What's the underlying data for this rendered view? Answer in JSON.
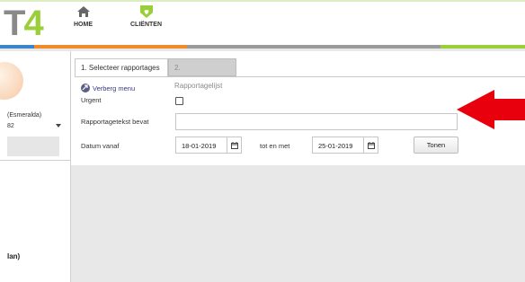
{
  "header": {
    "logo_text_a": "T",
    "logo_text_b": "4",
    "nav": [
      {
        "label": "HOME",
        "icon": "home-icon"
      },
      {
        "label": "CLIËNTEN",
        "icon": "tag-heart-icon"
      }
    ]
  },
  "colors": {
    "bar_gray": "#9a9a9a",
    "bar_blue": "#3a86c8",
    "bar_orange": "#f08a2a",
    "bar_green": "#9bcf3a",
    "link_blue": "#333a85",
    "arrow_red": "#e8000c",
    "accent_green": "#9bcf3a"
  },
  "sidebar": {
    "client_name_fragment": "(Esmeralda)",
    "client_number_fragment": "82",
    "bottom_item_fragment": "lan)"
  },
  "tabs": [
    {
      "label": "1. Selecteer rapportages",
      "active": true
    },
    {
      "label": "2. Rapportagelijst",
      "active": false
    }
  ],
  "form": {
    "menu_toggle": "Verberg menu",
    "urgent_label": "Urgent",
    "urgent_checked": false,
    "report_text_label": "Rapportagetekst bevat",
    "report_text_value": "",
    "date_from_label": "Datum vanaf",
    "date_from_value": "18-01-2019",
    "date_to_label": "tot en met",
    "date_to_value": "25-01-2019",
    "submit_label": "Tonen"
  }
}
